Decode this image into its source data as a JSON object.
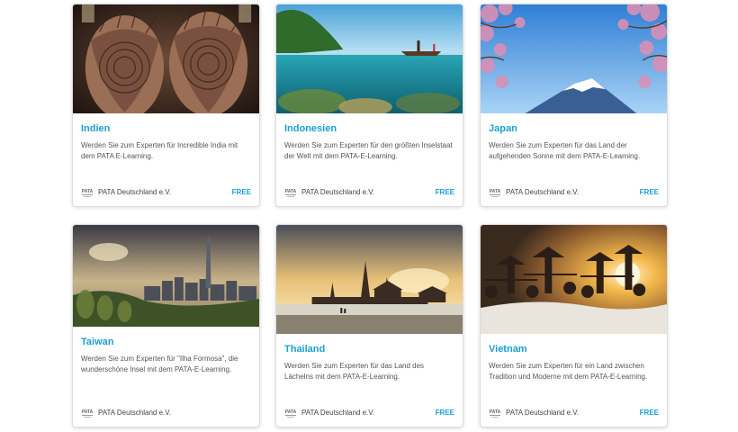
{
  "courses": [
    {
      "title": "Indien",
      "description": "Werden Sie zum Experten für Incredible India mit dem PATA E-Learning.",
      "provider": "PATA Deutschland e.V.",
      "logo_text": "PATA",
      "price": "FREE",
      "image_icon": "henna-hands-image"
    },
    {
      "title": "Indonesien",
      "description": "Werden Sie zum Experten für den größten Inselstaat der Welt mit dem PATA-E-Learning.",
      "provider": "PATA Deutschland e.V.",
      "logo_text": "PATA",
      "price": "FREE",
      "image_icon": "underwater-boat-image"
    },
    {
      "title": "Japan",
      "description": "Werden Sie zum Experten für das Land der aufgehenden Sonne mit dem PATA-E-Learning.",
      "provider": "PATA Deutschland e.V.",
      "logo_text": "PATA",
      "price": "FREE",
      "image_icon": "mount-fuji-blossom-image"
    },
    {
      "title": "Taiwan",
      "description": "Werden Sie zum Experten für \"Ilha Formosa\", die wunderschöne Insel mit dem PATA-E-Learning.",
      "provider": "PATA Deutschland e.V.",
      "logo_text": "PATA",
      "price": "",
      "image_icon": "taipei-skyline-image"
    },
    {
      "title": "Thailand",
      "description": "Werden Sie zum Experten für das Land des Lächelns mit dem PATA-E-Learning.",
      "provider": "PATA Deutschland e.V.",
      "logo_text": "PATA",
      "price": "FREE",
      "image_icon": "bangkok-temple-image"
    },
    {
      "title": "Vietnam",
      "description": "Werden Sie zum Experten für ein Land zwischen Tradition und Moderne mit dem PATA-E-Learning.",
      "provider": "PATA Deutschland e.V.",
      "logo_text": "PATA",
      "price": "FREE",
      "image_icon": "salt-field-workers-image"
    }
  ],
  "colors": {
    "accent": "#1a9fd4",
    "text": "#555555",
    "border": "#dcdcdc"
  }
}
